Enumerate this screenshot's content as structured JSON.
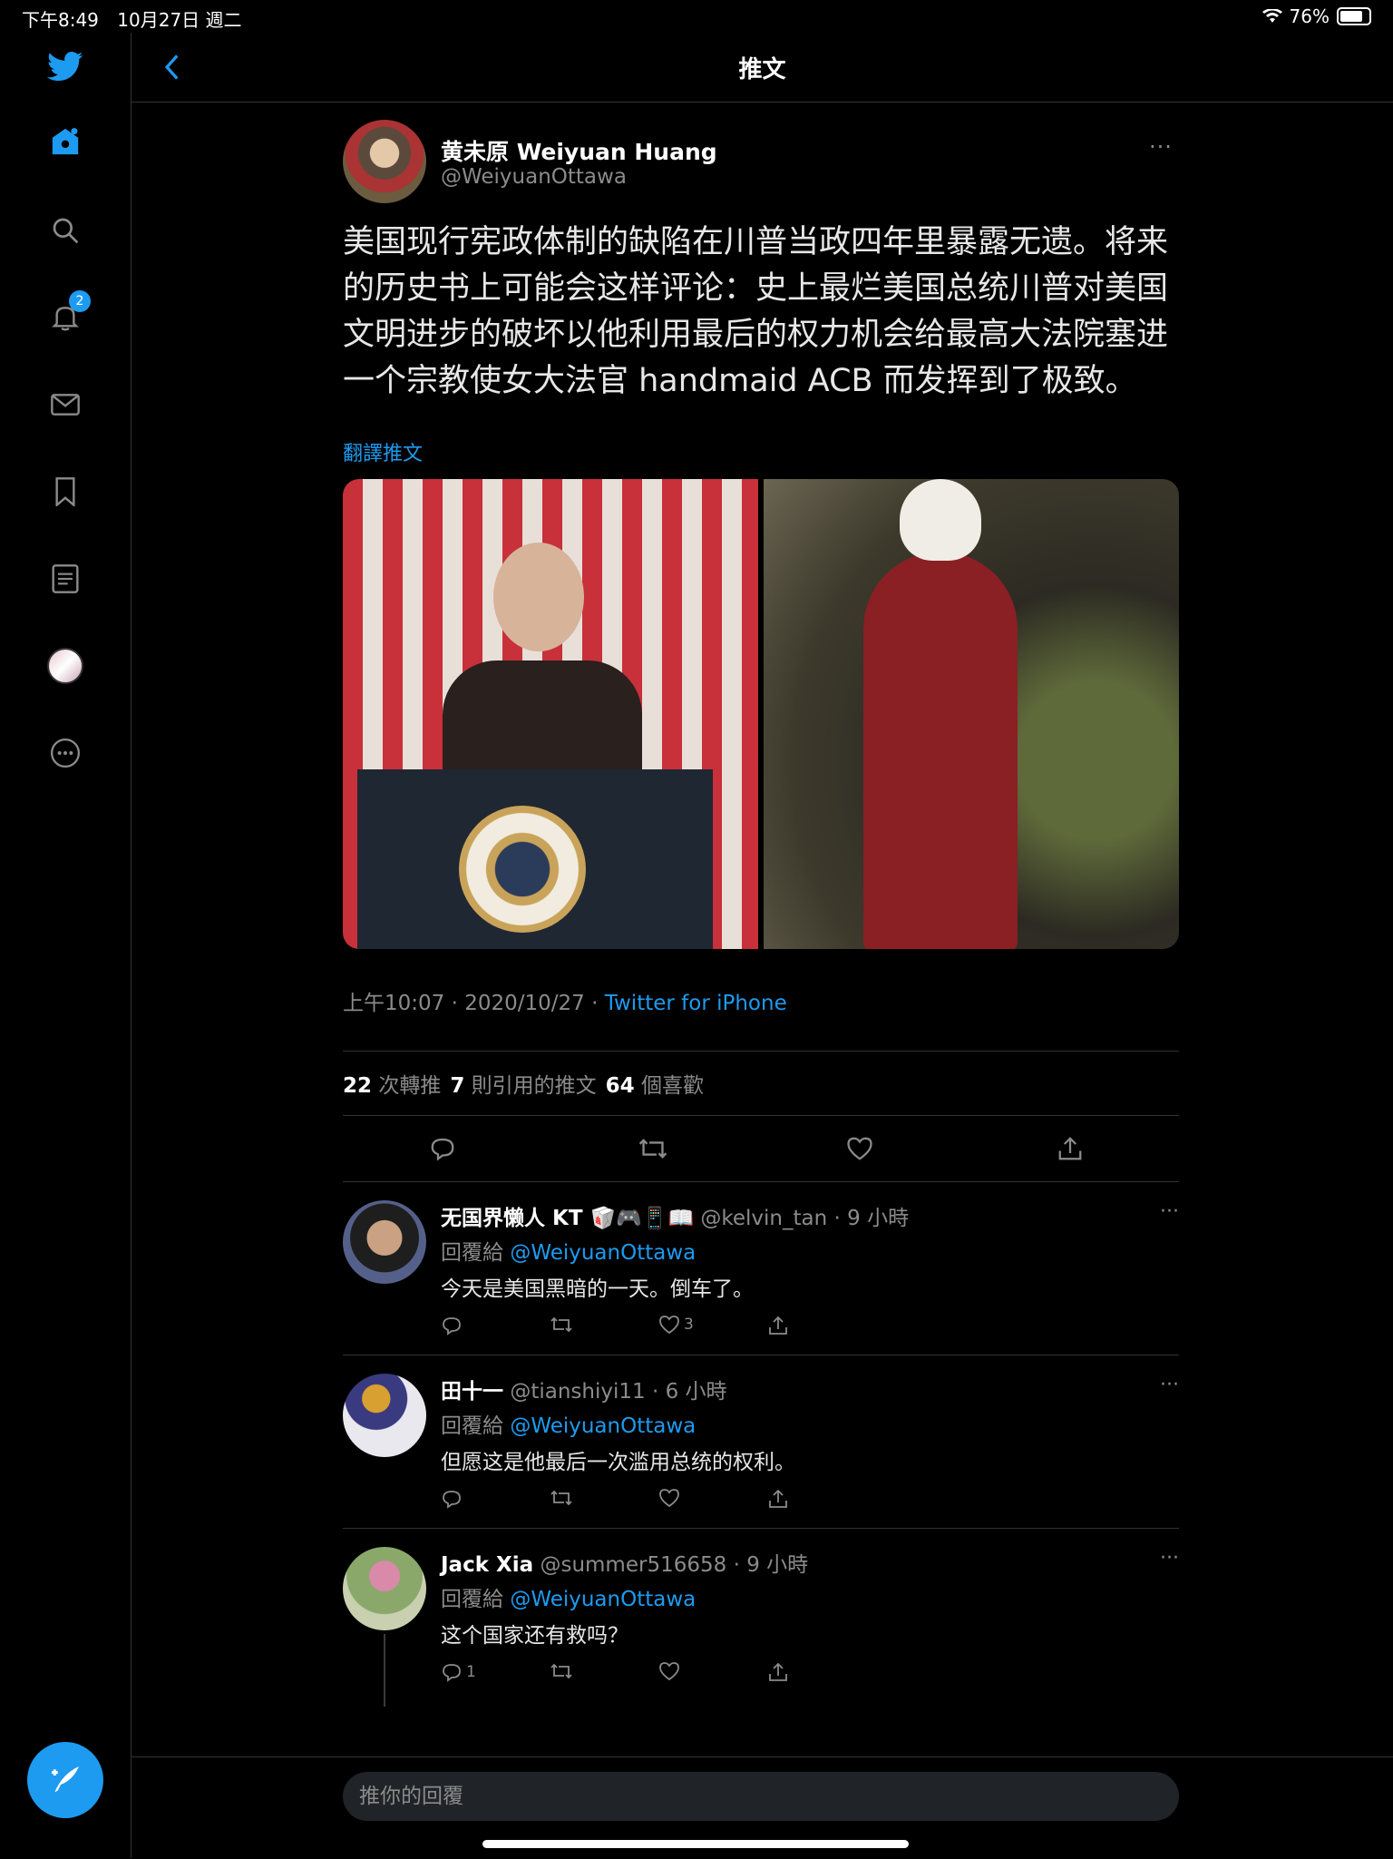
{
  "status": {
    "time": "下午8:49",
    "date": "10月27日 週二",
    "battery": "76%"
  },
  "header": {
    "title": "推文"
  },
  "sidebar": {
    "notifications_badge": "2"
  },
  "tweet": {
    "author_name": "黄未原 Weiyuan Huang",
    "author_handle": "@WeiyuanOttawa",
    "text": "美国现行宪政体制的缺陷在川普当政四年里暴露无遗。将来的历史书上可能会这样评论：史上最烂美国总统川普对美国文明进步的破坏以他利用最后的权力机会给最高大法院塞进一个宗教使女大法官 handmaid ACB 而发挥到了极致。",
    "translate_label": "翻譯推文",
    "time": "上午10:07",
    "date": "2020/10/27",
    "source": "Twitter for iPhone",
    "stats": {
      "retweets": "22",
      "retweets_label": "次轉推",
      "quotes": "7",
      "quotes_label": "則引用的推文",
      "likes": "64",
      "likes_label": "個喜歡"
    }
  },
  "replies": [
    {
      "name": "无国界懒人 KT 🥡🎮📱📖",
      "handle": "@kelvin_tan",
      "time": "9 小時",
      "to_label": "回覆給",
      "to": "@WeiyuanOttawa",
      "text": "今天是美国黑暗的一天。倒车了。",
      "reply_count": "",
      "like_count": "3"
    },
    {
      "name": "田十一",
      "handle": "@tianshiyi11",
      "time": "6 小時",
      "to_label": "回覆給",
      "to": "@WeiyuanOttawa",
      "text": "但愿这是他最后一次滥用总统的权利。",
      "reply_count": "",
      "like_count": ""
    },
    {
      "name": "Jack Xia",
      "handle": "@summer516658",
      "time": "9 小時",
      "to_label": "回覆給",
      "to": "@WeiyuanOttawa",
      "text": "这个国家还有救吗？",
      "reply_count": "1",
      "like_count": ""
    }
  ],
  "composer": {
    "placeholder": "推你的回覆"
  },
  "colors": {
    "accent": "#1d9bf0",
    "background": "#000000"
  }
}
